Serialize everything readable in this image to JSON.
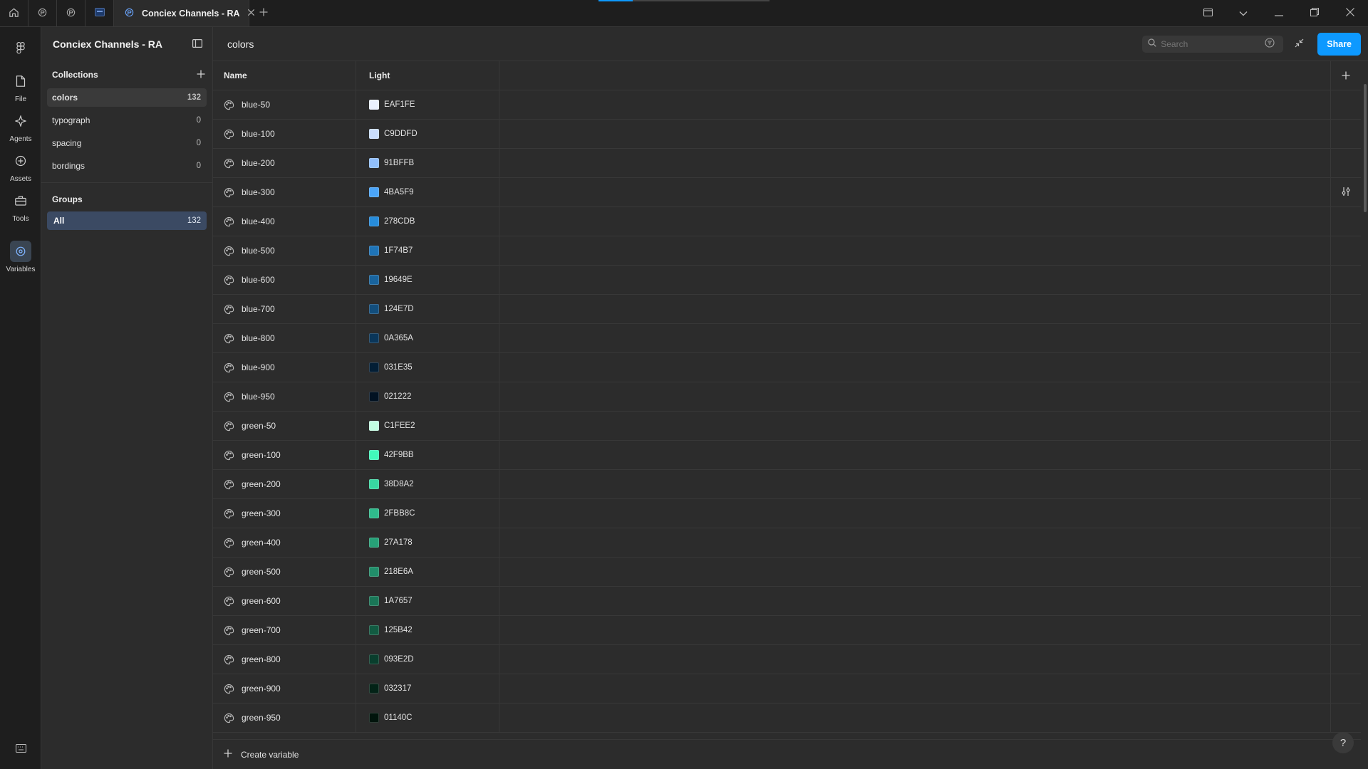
{
  "tabbar": {
    "active_tab_title": "Conciex Channels - RA",
    "progress_fraction": 0.2
  },
  "rail": {
    "items": [
      {
        "label": "File",
        "icon": "file-icon"
      },
      {
        "label": "Agents",
        "icon": "sparkle-icon"
      },
      {
        "label": "Assets",
        "icon": "assets-icon"
      },
      {
        "label": "Tools",
        "icon": "toolbox-icon"
      },
      {
        "label": "Variables",
        "icon": "variables-icon"
      }
    ]
  },
  "panel": {
    "file_title": "Conciex Channels - RA",
    "collections_heading": "Collections",
    "collections": [
      {
        "name": "colors",
        "count": "132"
      },
      {
        "name": "typograph",
        "count": "0"
      },
      {
        "name": "spacing",
        "count": "0"
      },
      {
        "name": "bordings",
        "count": "0"
      }
    ],
    "groups_heading": "Groups",
    "groups": [
      {
        "name": "All",
        "count": "132"
      }
    ]
  },
  "main": {
    "collection_title": "colors",
    "search_placeholder": "Search",
    "share_label": "Share",
    "columns": {
      "name": "Name",
      "mode": "Light"
    },
    "create_variable_label": "Create variable",
    "help_label": "?"
  },
  "variables": [
    {
      "name": "blue-50",
      "hex": "EAF1FE",
      "color": "#EAF1FE"
    },
    {
      "name": "blue-100",
      "hex": "C9DDFD",
      "color": "#C9DDFD"
    },
    {
      "name": "blue-200",
      "hex": "91BFFB",
      "color": "#91BFFB"
    },
    {
      "name": "blue-300",
      "hex": "4BA5F9",
      "color": "#4BA5F9"
    },
    {
      "name": "blue-400",
      "hex": "278CDB",
      "color": "#278CDB"
    },
    {
      "name": "blue-500",
      "hex": "1F74B7",
      "color": "#1F74B7"
    },
    {
      "name": "blue-600",
      "hex": "19649E",
      "color": "#19649E"
    },
    {
      "name": "blue-700",
      "hex": "124E7D",
      "color": "#124E7D"
    },
    {
      "name": "blue-800",
      "hex": "0A365A",
      "color": "#0A365A"
    },
    {
      "name": "blue-900",
      "hex": "031E35",
      "color": "#031E35"
    },
    {
      "name": "blue-950",
      "hex": "021222",
      "color": "#021222"
    },
    {
      "name": "green-50",
      "hex": "C1FEE2",
      "color": "#C1FEE2"
    },
    {
      "name": "green-100",
      "hex": "42F9BB",
      "color": "#42F9BB"
    },
    {
      "name": "green-200",
      "hex": "38D8A2",
      "color": "#38D8A2"
    },
    {
      "name": "green-300",
      "hex": "2FBB8C",
      "color": "#2FBB8C"
    },
    {
      "name": "green-400",
      "hex": "27A178",
      "color": "#27A178"
    },
    {
      "name": "green-500",
      "hex": "218E6A",
      "color": "#218E6A"
    },
    {
      "name": "green-600",
      "hex": "1A7657",
      "color": "#1A7657"
    },
    {
      "name": "green-700",
      "hex": "125B42",
      "color": "#125B42"
    },
    {
      "name": "green-800",
      "hex": "093E2D",
      "color": "#093E2D"
    },
    {
      "name": "green-900",
      "hex": "032317",
      "color": "#032317"
    },
    {
      "name": "green-950",
      "hex": "01140C",
      "color": "#01140C"
    }
  ],
  "colors": {
    "accent": "#0d99ff",
    "group_selected": "#3b4a63"
  }
}
